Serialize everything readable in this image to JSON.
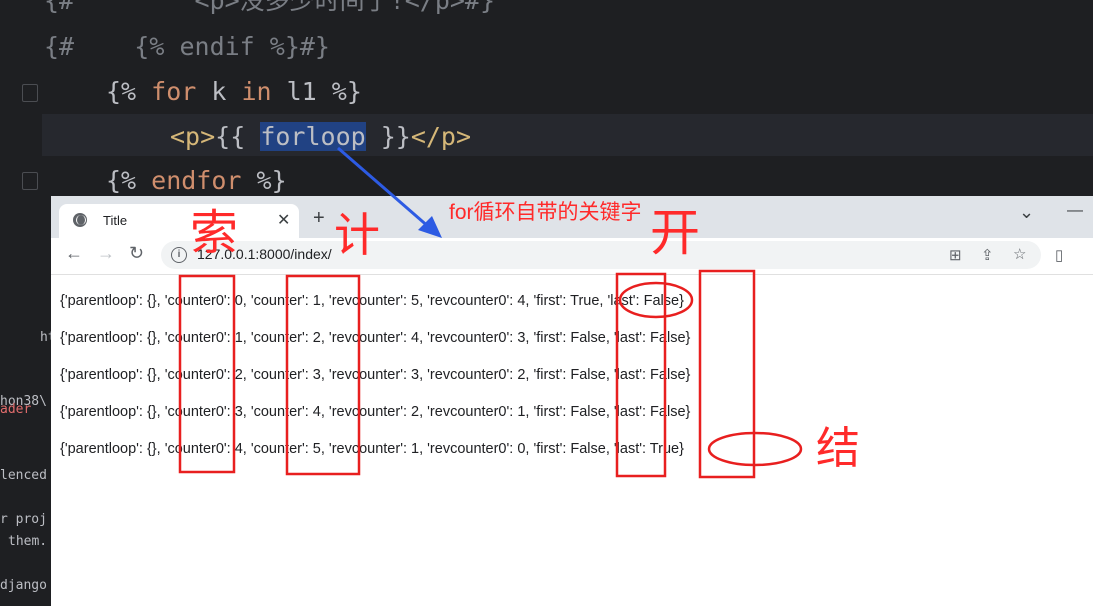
{
  "ide": {
    "lines": [
      {
        "text": "{#        <p>没多少时间了!</p>#}"
      },
      {
        "text": "{#    {% endif %}#}"
      },
      {
        "k1": "{% ",
        "kw1": "for",
        "mid": " k ",
        "kw2": "in",
        "rest": " l1 %}"
      },
      {
        "pre": "<p>",
        "brace": "{{ ",
        "selected": "forloop",
        "post": " }}",
        "tagclose": "</p>"
      },
      {
        "k1": "{% ",
        "kw1": "endfor",
        "rest": " %}"
      }
    ],
    "side_fragments": [
      "ht",
      "hon38\\",
      "ader",
      "lenced",
      "r proj",
      "them.",
      "django"
    ]
  },
  "browser": {
    "tab_title": "Title",
    "tab_close": "✕",
    "new_tab": "+",
    "minimize": "—",
    "dropdown": "⌄",
    "url": "127.0.0.1:8000/index/",
    "info": "i",
    "nav": {
      "back": "←",
      "forward": "→",
      "reload": "↻"
    },
    "toolbar_icons": {
      "translate": "⊞",
      "share": "⇪",
      "bookmark": "☆",
      "sidebar": "▯"
    }
  },
  "content": {
    "rows": [
      "{'parentloop': {}, 'counter0': 0, 'counter': 1, 'revcounter': 5, 'revcounter0': 4, 'first': True, 'last': False}",
      "{'parentloop': {}, 'counter0': 1, 'counter': 2, 'revcounter': 4, 'revcounter0': 3, 'first': False, 'last': False}",
      "{'parentloop': {}, 'counter0': 2, 'counter': 3, 'revcounter': 3, 'revcounter0': 2, 'first': False, 'last': False}",
      "{'parentloop': {}, 'counter0': 3, 'counter': 4, 'revcounter': 2, 'revcounter0': 1, 'first': False, 'last': False}",
      "{'parentloop': {}, 'counter0': 4, 'counter': 5, 'revcounter': 1, 'revcounter0': 0, 'first': False, 'last': True}"
    ]
  },
  "annotations": {
    "caption": "for循环自带的关键字",
    "hw_index": "索",
    "hw_count": "计",
    "hw_start": "开",
    "hw_end": "结",
    "color": "#ff2a2a"
  }
}
